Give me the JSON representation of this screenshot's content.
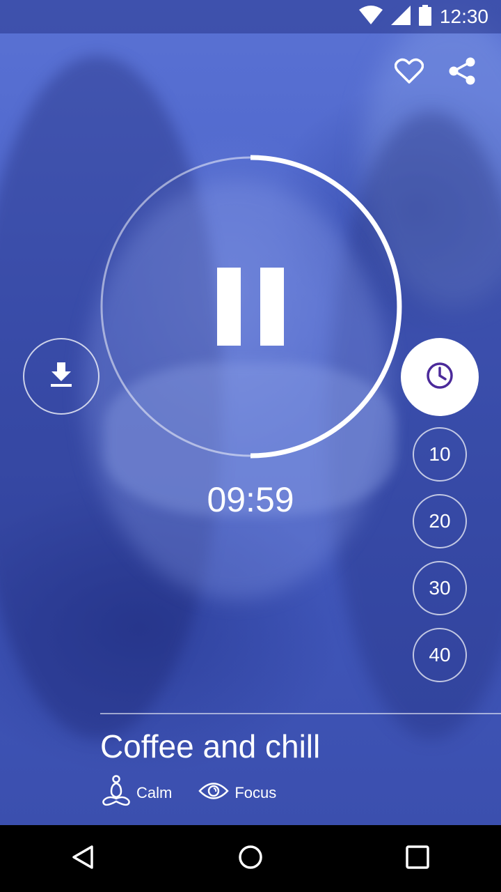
{
  "status_bar": {
    "time": "12:30",
    "icons": [
      "wifi-icon",
      "cell-signal-icon",
      "battery-icon"
    ]
  },
  "top_actions": {
    "icons": [
      "heart-icon",
      "share-icon"
    ]
  },
  "player": {
    "state": "playing",
    "progress": 0.5,
    "remaining_time": "09:59"
  },
  "timer_options": {
    "icon": "clock-icon",
    "minutes": [
      "10",
      "20",
      "30",
      "40"
    ]
  },
  "track": {
    "title": "Coffee and chill",
    "tags": [
      {
        "label": "Calm",
        "icon": "meditation-icon"
      },
      {
        "label": "Focus",
        "icon": "eye-icon"
      }
    ]
  },
  "nav": {
    "icons": [
      "back-icon",
      "home-icon",
      "recents-icon"
    ]
  },
  "colors": {
    "overlay": "#4a62c8",
    "clock_accent": "#4b2a9a"
  }
}
